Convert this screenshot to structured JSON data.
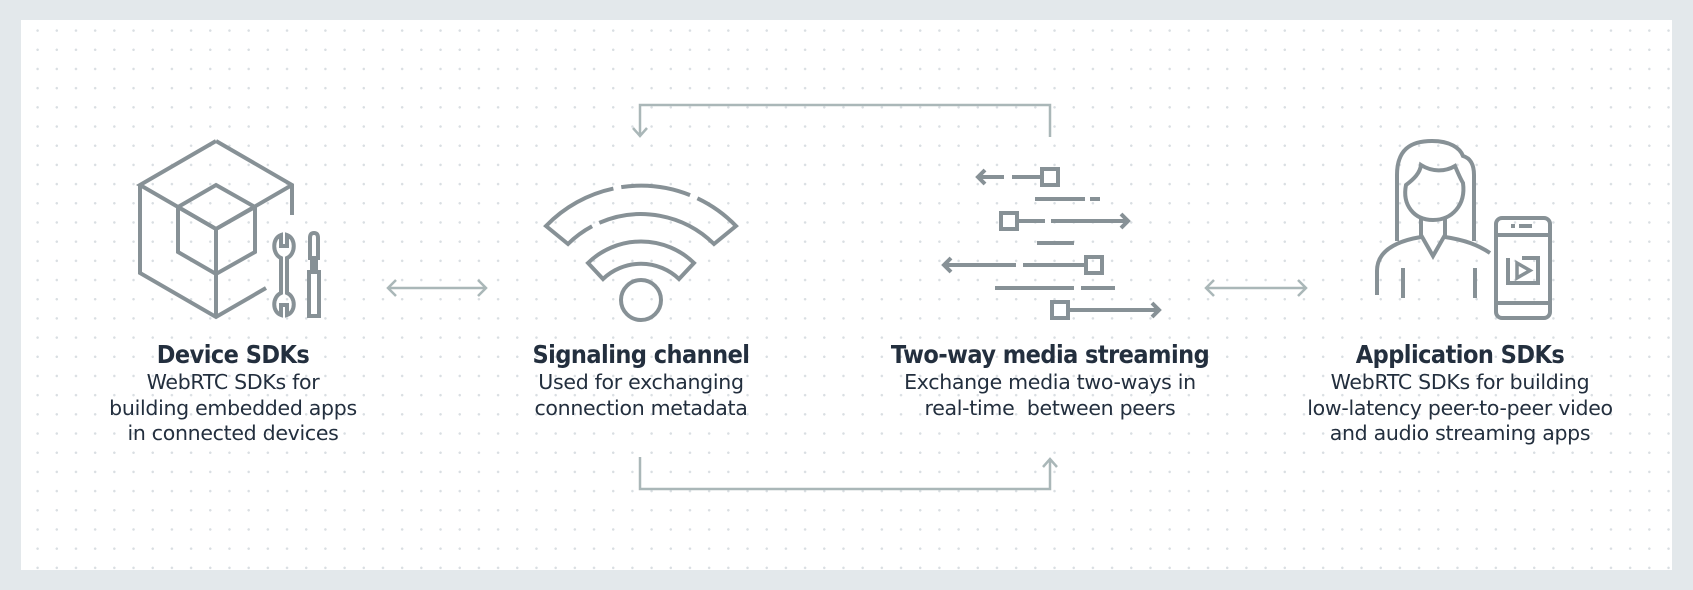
{
  "colors": {
    "background": "#e3e8eb",
    "panel": "#ffffff",
    "icon_stroke": "#879196",
    "connector_stroke": "#aab7b8",
    "text": "#232f3e"
  },
  "nodes": [
    {
      "id": "device-sdks",
      "icon": "cube-with-tools-icon",
      "title": "Device SDKs",
      "description_lines": [
        "WebRTC SDKs for",
        "building embedded apps",
        "in connected devices"
      ]
    },
    {
      "id": "signaling-channel",
      "icon": "wifi-signal-icon",
      "title": "Signaling channel",
      "description_lines": [
        "Used for exchanging",
        "connection metadata"
      ]
    },
    {
      "id": "two-way-media-streaming",
      "icon": "bidirectional-stream-icon",
      "title": "Two-way media streaming",
      "description_lines": [
        "Exchange media two-ways in",
        "real-time  between peers"
      ]
    },
    {
      "id": "application-sdks",
      "icon": "person-with-phone-video-icon",
      "title": "Application SDKs",
      "description_lines": [
        "WebRTC SDKs for building",
        "low-latency peer-to-peer video",
        "and audio streaming apps"
      ]
    }
  ],
  "connectors": [
    {
      "from": "device-sdks",
      "to": "signaling-channel",
      "type": "bidirectional"
    },
    {
      "from": "two-way-media-streaming",
      "to": "signaling-channel",
      "type": "loop-top"
    },
    {
      "from": "signaling-channel",
      "to": "two-way-media-streaming",
      "type": "loop-bottom"
    },
    {
      "from": "two-way-media-streaming",
      "to": "application-sdks",
      "type": "bidirectional"
    }
  ]
}
